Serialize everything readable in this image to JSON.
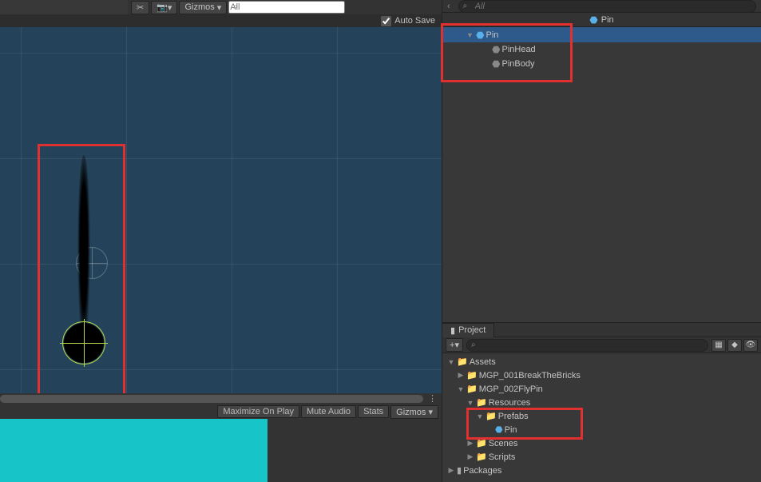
{
  "sceneToolbar": {
    "gizmos": "Gizmos",
    "searchPlaceholder": "All"
  },
  "autoSave": {
    "label": "Auto Save",
    "checked": true
  },
  "prefabHeader": {
    "name": "Pin"
  },
  "hierarchy": {
    "root": "Pin",
    "children": [
      "PinHead",
      "PinBody"
    ]
  },
  "gameToolbar": {
    "maximize": "Maximize On Play",
    "mute": "Mute Audio",
    "stats": "Stats",
    "gizmos": "Gizmos"
  },
  "rightTopSearch": {
    "placeholder": "All"
  },
  "project": {
    "tab": "Project",
    "plus": "+",
    "searchPlaceholder": "",
    "tree": {
      "assets": "Assets",
      "mgp001": "MGP_001BreakTheBricks",
      "mgp002": "MGP_002FlyPin",
      "resources": "Resources",
      "prefabs": "Prefabs",
      "pin": "Pin",
      "scenes": "Scenes",
      "scripts": "Scripts",
      "packages": "Packages"
    }
  }
}
